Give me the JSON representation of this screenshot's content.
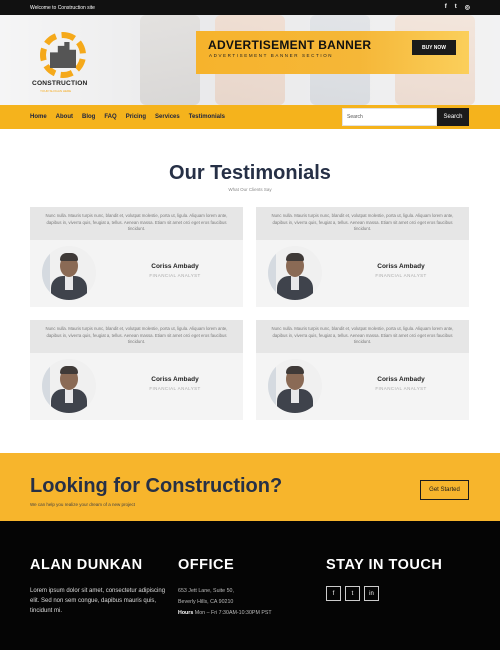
{
  "topbar": {
    "welcome": "Welcome to Construction site",
    "social": [
      {
        "icon": "facebook-icon",
        "glyph": "f"
      },
      {
        "icon": "twitter-icon",
        "glyph": "t"
      },
      {
        "icon": "instagram-icon",
        "glyph": "◎"
      }
    ]
  },
  "logo": {
    "name": "CONSTRUCTION",
    "tagline": "YOUR SLOGAN HERE"
  },
  "ad_banner": {
    "title": "ADVERTISEMENT BANNER",
    "subtitle": "ADVERTISEMENT BANNER SECTION",
    "button": "BUY NOW"
  },
  "nav": {
    "items": [
      "Home",
      "About",
      "Blog",
      "FAQ",
      "Pricing",
      "Services",
      "Testimonials"
    ],
    "search_placeholder": "Search",
    "search_button": "Search"
  },
  "testimonials": {
    "title": "Our Testimonials",
    "subtitle": "What Our Clients Say",
    "cards": [
      {
        "quote": "Nunc nulla. Mauris turpis nunc, blandit et, volutpat molestie, porta ut, ligula. Aliquam lorem ante, dapibus in, viverra quis, feugiat a, tellus. Aenean massa. Etiam sit amet orci eget eros faucibus tincidunt.",
        "name": "Coriss Ambady",
        "role": "FINANCIAL ANALYST"
      },
      {
        "quote": "Nunc nulla. Mauris turpis nunc, blandit et, volutpat molestie, porta ut, ligula. Aliquam lorem ante, dapibus in, viverra quis, feugiat a, tellus. Aenean massa. Etiam sit amet orci eget eros faucibus tincidunt.",
        "name": "Coriss Ambady",
        "role": "FINANCIAL ANALYST"
      },
      {
        "quote": "Nunc nulla. Mauris turpis nunc, blandit et, volutpat molestie, porta ut, ligula. Aliquam lorem ante, dapibus in, viverra quis, feugiat a, tellus. Aenean massa. Etiam sit amet orci eget eros faucibus tincidunt.",
        "name": "Coriss Ambady",
        "role": "FINANCIAL ANALYST"
      },
      {
        "quote": "Nunc nulla. Mauris turpis nunc, blandit et, volutpat molestie, porta ut, ligula. Aliquam lorem ante, dapibus in, viverra quis, feugiat a, tellus. Aenean massa. Etiam sit amet orci eget eros faucibus tincidunt.",
        "name": "Coriss Ambady",
        "role": "FINANCIAL ANALYST"
      }
    ]
  },
  "cta": {
    "title": "Looking for Construction?",
    "subtitle": "We can help you realize your dream of a new project",
    "button": "Get Started"
  },
  "footer": {
    "about_title": "ALAN DUNKAN",
    "about_text": "Lorem ipsum dolor sit amet, consectetur adipiscing elit. Sed non sem congue, dapibus mauris quis, tincidunt mi.",
    "office_title": "OFFICE",
    "address_line1": "653 Jett Lane, Suite 50,",
    "address_line2": "Beverly Hills, CA 90210",
    "hours_label": "Hours",
    "hours_value": "Mon – Fri 7:30AM-10:30PM PST",
    "social_title": "STAY IN TOUCH",
    "social": [
      {
        "icon": "facebook-icon",
        "glyph": "f"
      },
      {
        "icon": "twitter-icon",
        "glyph": "t"
      },
      {
        "icon": "linkedin-icon",
        "glyph": "in"
      }
    ]
  },
  "colors": {
    "accent": "#f5b31c",
    "dark": "#263046",
    "black": "#050505"
  }
}
